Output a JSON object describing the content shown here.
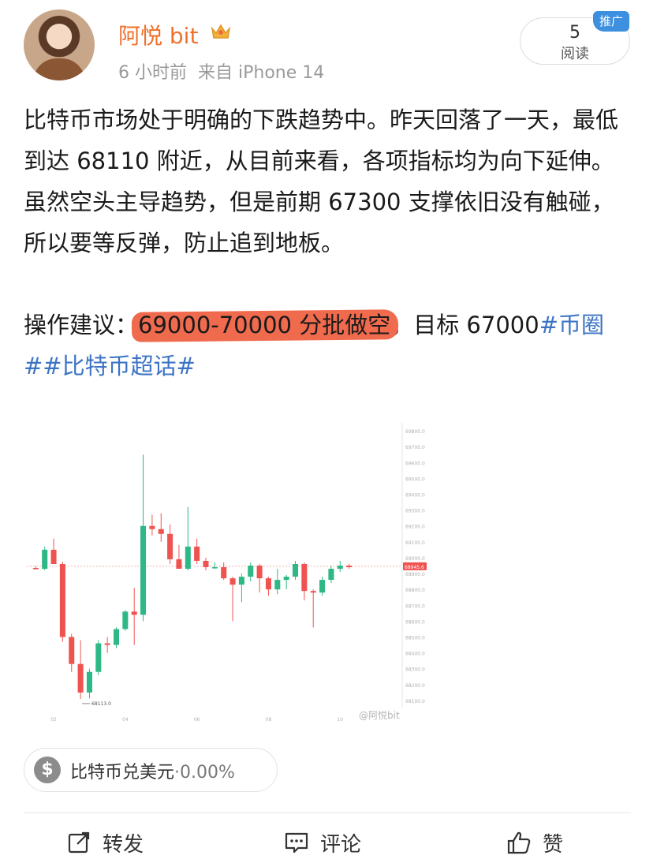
{
  "author": {
    "name": "阿悦 bit",
    "badge_icon": "crown-icon"
  },
  "meta": {
    "time": "6 小时前",
    "source": "来自 iPhone 14"
  },
  "reads": {
    "count": "5",
    "label": "阅读",
    "promo": "推广"
  },
  "post": {
    "line1": "比特币市场处于明确的下跌趋势中。昨天回落了一天，最低到达 68110 附近，从目前来看，各项指标均为向下延伸。",
    "line2": "虽然空头主导趋势，但是前期 67300 支撑依旧没有触碰，所以要等反弹，防止追到地板。",
    "advice_label": "操作建议：",
    "advice_highlight": "69000-70000 分批做空",
    "advice_rest": "，目标 67000",
    "topics": "#币圈##比特币超话#"
  },
  "chart_data": {
    "type": "candlestick",
    "y_ticks": [
      "69800.0",
      "69700.0",
      "69600.0",
      "69500.0",
      "69400.0",
      "69300.0",
      "69200.0",
      "69100.0",
      "69000.0",
      "68900.0",
      "68800.0",
      "68700.0",
      "68600.0",
      "68500.0",
      "68400.0",
      "68300.0",
      "68200.0",
      "68100.0"
    ],
    "ylim": [
      68050,
      69850
    ],
    "x_ticks": [
      "02",
      "04",
      "06",
      "08",
      "10"
    ],
    "current_price": "68945.6",
    "low_label": "68113.0",
    "up_color": "#2eb886",
    "down_color": "#ef5350",
    "candles": [
      {
        "o": 68935,
        "h": 68945,
        "l": 68925,
        "c": 68930
      },
      {
        "o": 68930,
        "h": 69070,
        "l": 68920,
        "c": 69050
      },
      {
        "o": 69050,
        "h": 69120,
        "l": 68960,
        "c": 68960
      },
      {
        "o": 68960,
        "h": 68975,
        "l": 68470,
        "c": 68500
      },
      {
        "o": 68500,
        "h": 68520,
        "l": 68280,
        "c": 68330
      },
      {
        "o": 68330,
        "h": 68480,
        "l": 68110,
        "c": 68150
      },
      {
        "o": 68150,
        "h": 68300,
        "l": 68113,
        "c": 68280
      },
      {
        "o": 68280,
        "h": 68480,
        "l": 68260,
        "c": 68460
      },
      {
        "o": 68460,
        "h": 68500,
        "l": 68400,
        "c": 68450
      },
      {
        "o": 68450,
        "h": 68560,
        "l": 68430,
        "c": 68550
      },
      {
        "o": 68550,
        "h": 68670,
        "l": 68540,
        "c": 68660
      },
      {
        "o": 68660,
        "h": 68810,
        "l": 68450,
        "c": 68640
      },
      {
        "o": 68640,
        "h": 69650,
        "l": 68600,
        "c": 69200
      },
      {
        "o": 69200,
        "h": 69270,
        "l": 69140,
        "c": 69180
      },
      {
        "o": 69180,
        "h": 69280,
        "l": 69100,
        "c": 69150
      },
      {
        "o": 69150,
        "h": 69210,
        "l": 68960,
        "c": 68990
      },
      {
        "o": 68990,
        "h": 69080,
        "l": 68940,
        "c": 68930
      },
      {
        "o": 68930,
        "h": 69320,
        "l": 68920,
        "c": 69070
      },
      {
        "o": 69070,
        "h": 69120,
        "l": 68960,
        "c": 68980
      },
      {
        "o": 68980,
        "h": 69000,
        "l": 68920,
        "c": 68940
      },
      {
        "o": 68940,
        "h": 68970,
        "l": 68930,
        "c": 68940
      },
      {
        "o": 68940,
        "h": 68970,
        "l": 68860,
        "c": 68870
      },
      {
        "o": 68870,
        "h": 68880,
        "l": 68600,
        "c": 68830
      },
      {
        "o": 68830,
        "h": 68900,
        "l": 68720,
        "c": 68880
      },
      {
        "o": 68880,
        "h": 68970,
        "l": 68850,
        "c": 68950
      },
      {
        "o": 68950,
        "h": 68960,
        "l": 68780,
        "c": 68870
      },
      {
        "o": 68870,
        "h": 68880,
        "l": 68760,
        "c": 68800
      },
      {
        "o": 68800,
        "h": 68930,
        "l": 68770,
        "c": 68860
      },
      {
        "o": 68860,
        "h": 68890,
        "l": 68800,
        "c": 68880
      },
      {
        "o": 68880,
        "h": 68980,
        "l": 68860,
        "c": 68960
      },
      {
        "o": 68960,
        "h": 68970,
        "l": 68730,
        "c": 68790
      },
      {
        "o": 68790,
        "h": 68800,
        "l": 68560,
        "c": 68780
      },
      {
        "o": 68780,
        "h": 68880,
        "l": 68760,
        "c": 68860
      },
      {
        "o": 68860,
        "h": 68950,
        "l": 68840,
        "c": 68930
      },
      {
        "o": 68930,
        "h": 68980,
        "l": 68910,
        "c": 68950
      },
      {
        "o": 68950,
        "h": 68960,
        "l": 68930,
        "c": 68940
      }
    ]
  },
  "watermark": "@阿悦bit",
  "tag": {
    "icon": "dollar-icon",
    "name": "比特币兑美元",
    "change": "·0.00%"
  },
  "actions": {
    "repost": "转发",
    "comment": "评论",
    "like": "赞"
  }
}
